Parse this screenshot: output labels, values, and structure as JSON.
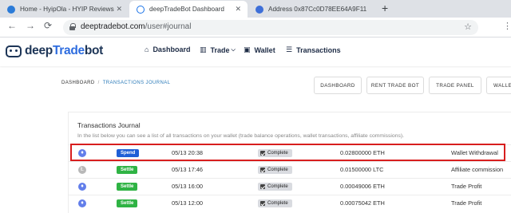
{
  "browser": {
    "tabs": [
      {
        "title": "Home - HyipOla - HYIP Reviews",
        "close": "✕",
        "icon": "hyipola-favicon"
      },
      {
        "title": "deepTradeBot Dashboard",
        "close": "✕",
        "icon": "deeptradebot-favicon"
      },
      {
        "title": "Address 0x87Cc0D78EE64A9F11",
        "icon": "etherscan-favicon"
      }
    ],
    "new_tab": "+",
    "nav": {
      "back": "←",
      "forward": "→",
      "reload": "⟳"
    },
    "url": {
      "host": "deeptradebot.com",
      "path": "/user#journal"
    },
    "star": "☆",
    "menu": "⋮"
  },
  "site": {
    "logo": {
      "part1": "deep",
      "part2": "Trade",
      "part3": "bot"
    },
    "nav": [
      {
        "icon": "⌂",
        "label": "Dashboard"
      },
      {
        "icon": "▥",
        "label": "Trade",
        "caret": "⌵"
      },
      {
        "icon": "▣",
        "label": "Wallet"
      },
      {
        "icon": "☰",
        "label": "Transactions"
      }
    ]
  },
  "breadcrumb": {
    "root": "DASHBOARD",
    "sep": "/",
    "current": "TRANSACTIONS JOURNAL"
  },
  "buttons": [
    "DASHBOARD",
    "RENT TRADE BOT",
    "TRADE PANEL",
    "WALLET"
  ],
  "journal": {
    "title": "Transactions Journal",
    "description": "In the list below you can see a list of all transactions on your wallet (trade balance operations, wallet transactions, affiliate commissions).",
    "rows": [
      {
        "coin": "eth",
        "coin_glyph": "♦",
        "type": "Spend",
        "date": "05/13 20:38",
        "status": "Complete",
        "amount": "0.02800000 ETH",
        "description": "Wallet Withdrawal"
      },
      {
        "coin": "ltc",
        "coin_glyph": "Ł",
        "type": "Settle",
        "date": "05/13 17:46",
        "status": "Complete",
        "amount": "0.01500000 LTC",
        "description": "Affiliate commission"
      },
      {
        "coin": "eth",
        "coin_glyph": "♦",
        "type": "Settle",
        "date": "05/13 16:00",
        "status": "Complete",
        "amount": "0.00049006 ETH",
        "description": "Trade Profit"
      },
      {
        "coin": "eth",
        "coin_glyph": "♦",
        "type": "Settle",
        "date": "05/13 12:00",
        "status": "Complete",
        "amount": "0.00075042 ETH",
        "description": "Trade Profit"
      }
    ]
  },
  "colors": {
    "spend": "#1f5fd6",
    "settle": "#2fb344",
    "highlight": "#d81e1e",
    "link": "#2a7ab8"
  }
}
